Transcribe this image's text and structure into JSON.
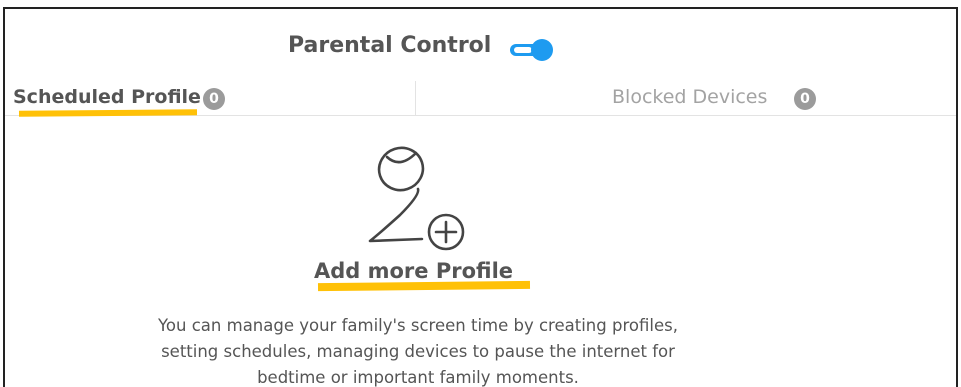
{
  "header": {
    "title": "Parental Control",
    "toggle_on": true,
    "accent_color": "#1e9bf0"
  },
  "tabs": [
    {
      "label": "Scheduled Profile",
      "count": "0",
      "active": true
    },
    {
      "label": "Blocked Devices",
      "count": "0",
      "active": false
    }
  ],
  "highlight_color": "#ffc107",
  "empty_state": {
    "icon": "add-profile-icon",
    "title": "Add more Profile",
    "description_lines": [
      "You can manage your family's screen time by creating profiles,",
      "setting schedules, managing devices to pause the internet for",
      "bedtime or important family moments."
    ]
  }
}
